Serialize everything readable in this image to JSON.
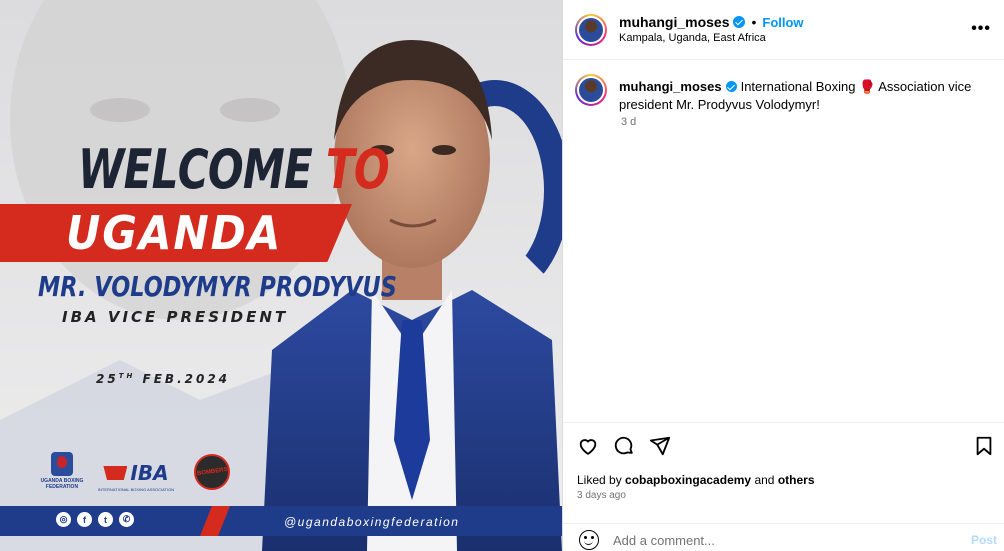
{
  "post": {
    "username": "muhangi_moses",
    "follow_label": "Follow",
    "separator": "•",
    "location": "Kampala, Uganda, East Africa",
    "more_label": "•••",
    "caption_user": "muhangi_moses",
    "caption_text": "International Boxing 🥊 Association vice president Mr. Prodyvus Volodymyr!",
    "caption_time": "3 d",
    "liked_by_prefix": "Liked by",
    "liked_by_user": "cobapboxingacademy",
    "liked_by_and": "and",
    "liked_by_others": "others",
    "posted_ago": "3 days ago",
    "comment_placeholder": "Add a comment...",
    "post_label": "Post"
  },
  "poster": {
    "welcome": "WELCOME",
    "to": "TO",
    "country": "UGANDA",
    "name": "MR. VOLODYMYR PRODYVUS",
    "role": "IBA VICE PRESIDENT",
    "date_day": "25",
    "date_sup": "TH",
    "date_rest": "FEB.2024",
    "ubf_text": "UGANDA BOXING FEDERATION",
    "iba_text": "IBA",
    "iba_sub": "INTERNATIONAL BOXING ASSOCIATION",
    "bombers_text": "BOMBERS",
    "handle": "@ugandaboxingfederation",
    "social_icons": [
      "instagram-icon",
      "facebook-icon",
      "twitter-icon",
      "whatsapp-icon"
    ]
  },
  "colors": {
    "accent_red": "#d52b1e",
    "accent_blue": "#1f3c8a",
    "link_blue": "#0095f6"
  }
}
